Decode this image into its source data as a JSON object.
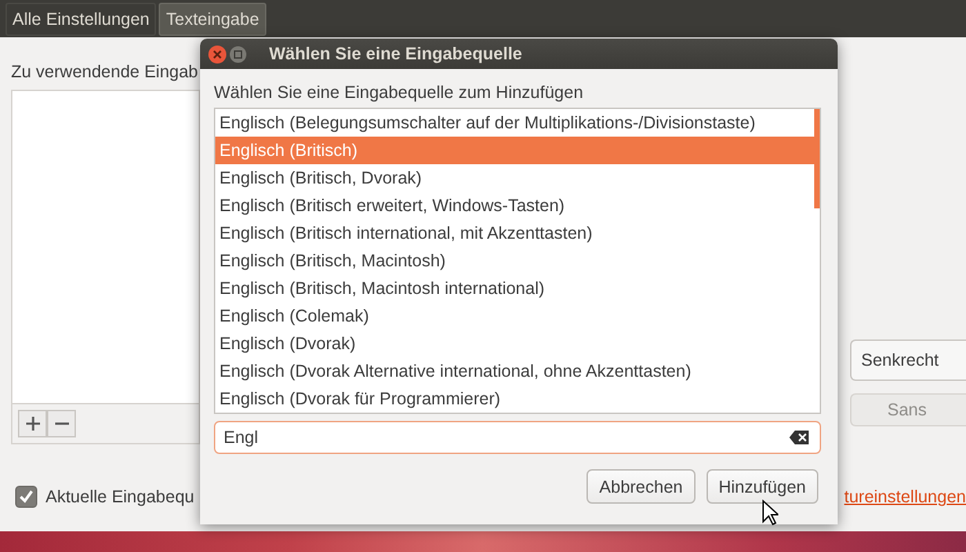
{
  "breadcrumbs": [
    {
      "label": "Alle Einstellungen",
      "selected": false
    },
    {
      "label": "Texteingabe",
      "selected": true
    }
  ],
  "settings": {
    "sources_label": "Zu verwendende  Eingab",
    "orientation": "Senkrecht",
    "font": "Sans",
    "show_current": {
      "label": "Aktuelle Eingabequ",
      "checked": true
    },
    "link": "tureinstellungen"
  },
  "dialog": {
    "title": "Wählen Sie eine Eingabequelle",
    "prompt": "Wählen Sie eine Eingabequelle zum Hinzufügen",
    "items": [
      {
        "label": "Englisch (Belegungsumschalter auf der Multiplikations-/Divisionstaste)",
        "selected": false
      },
      {
        "label": "Englisch (Britisch)",
        "selected": true
      },
      {
        "label": "Englisch (Britisch, Dvorak)",
        "selected": false
      },
      {
        "label": "Englisch (Britisch erweitert, Windows-Tasten)",
        "selected": false
      },
      {
        "label": "Englisch (Britisch international, mit Akzenttasten)",
        "selected": false
      },
      {
        "label": "Englisch (Britisch, Macintosh)",
        "selected": false
      },
      {
        "label": "Englisch (Britisch, Macintosh international)",
        "selected": false
      },
      {
        "label": "Englisch (Colemak)",
        "selected": false
      },
      {
        "label": "Englisch (Dvorak)",
        "selected": false
      },
      {
        "label": "Englisch (Dvorak Alternative international, ohne Akzenttasten)",
        "selected": false
      },
      {
        "label": "Englisch (Dvorak für Programmierer)",
        "selected": false
      }
    ],
    "search": {
      "value": "Engl"
    },
    "buttons": [
      "Abbrechen",
      "Hinzufügen"
    ]
  }
}
